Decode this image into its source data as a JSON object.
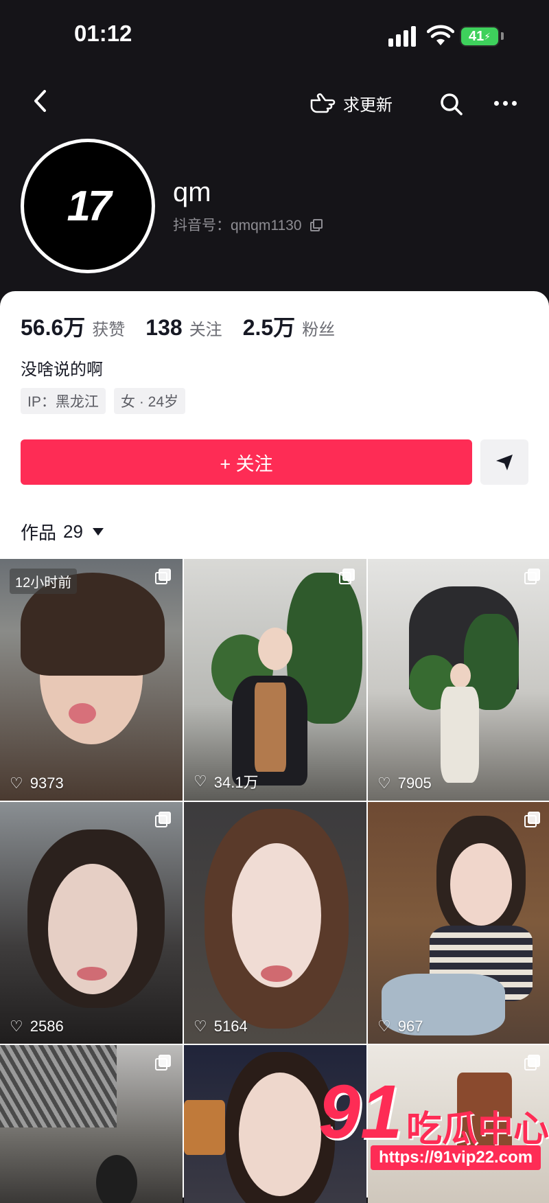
{
  "status_bar": {
    "time": "01:12",
    "battery": "41"
  },
  "nav": {
    "update_label": "求更新"
  },
  "profile": {
    "avatar_text": "17",
    "username": "qm",
    "douyin_id": "抖音号：qmqm1130"
  },
  "stats": [
    {
      "value": "56.6万",
      "label": "获赞"
    },
    {
      "value": "138",
      "label": "关注"
    },
    {
      "value": "2.5万",
      "label": "粉丝"
    }
  ],
  "bio": "没啥说的啊",
  "tags": [
    "IP：黑龙江",
    "女 · 24岁"
  ],
  "follow_label": "+ 关注",
  "works": {
    "label": "作品",
    "count": "29"
  },
  "posts": [
    {
      "likes": "9373",
      "badge": "12小时前"
    },
    {
      "likes": "34.1万"
    },
    {
      "likes": "7905"
    },
    {
      "likes": "2586"
    },
    {
      "likes": "5164"
    },
    {
      "likes": "967"
    },
    {
      "likes": ""
    },
    {
      "likes": ""
    },
    {
      "likes": ""
    }
  ],
  "watermark": {
    "number": "91",
    "text": "吃瓜中心",
    "url": "https://91vip22.com"
  },
  "colors": {
    "accent": "#fe2c55",
    "dark_bg": "#151418"
  }
}
